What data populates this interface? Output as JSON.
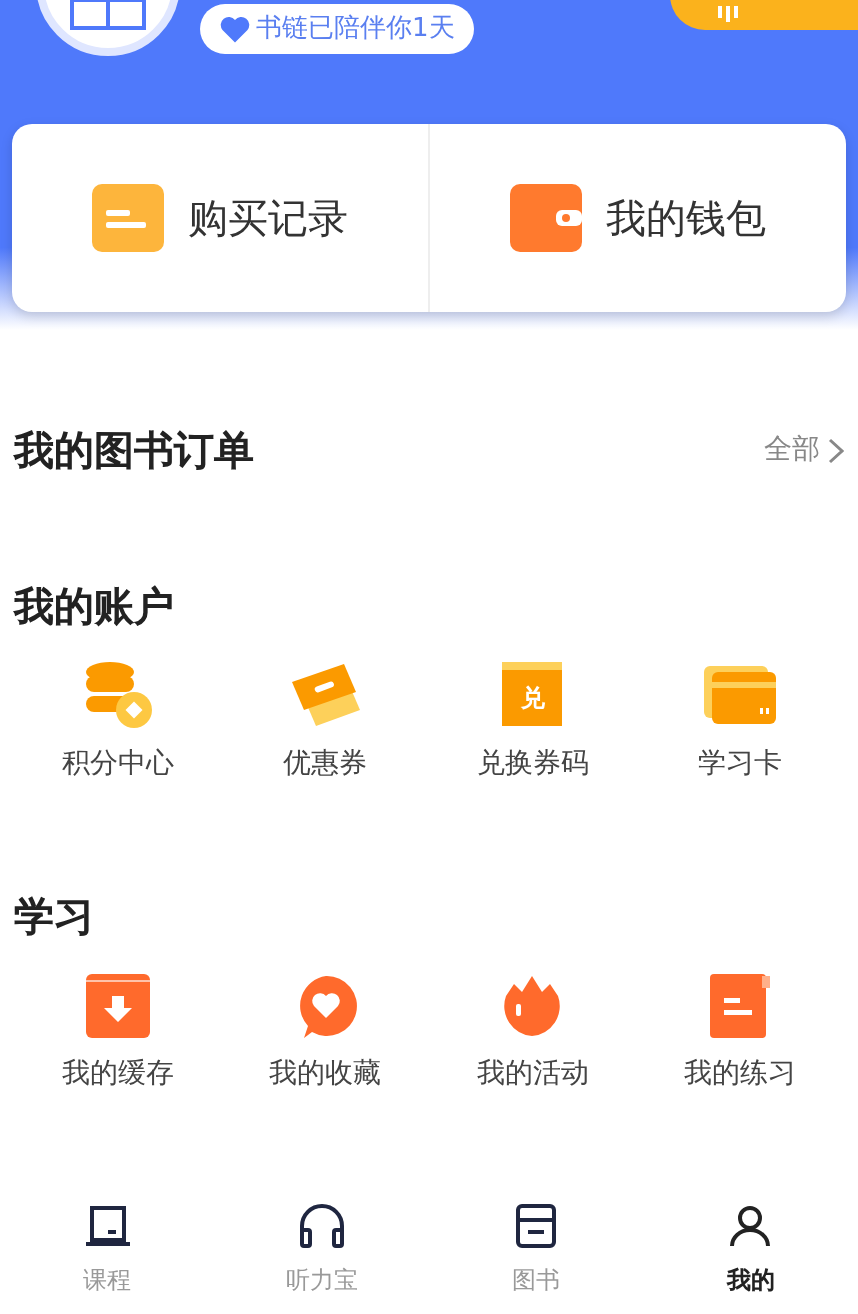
{
  "profile": {
    "badge": "书链已陪伴你1天"
  },
  "quick_links": [
    {
      "kind": "record",
      "label": "购买记录"
    },
    {
      "kind": "wallet",
      "label": "我的钱包"
    }
  ],
  "orders": {
    "title": "我的图书订单",
    "more": "全部"
  },
  "account": {
    "title": "我的账户",
    "items": [
      {
        "kind": "coins",
        "label": "积分中心"
      },
      {
        "kind": "coupon",
        "label": "优惠券"
      },
      {
        "kind": "redeem",
        "label": "兑换券码",
        "icon_text": "兑"
      },
      {
        "kind": "card",
        "label": "学习卡"
      }
    ]
  },
  "study": {
    "title": "学习",
    "items": [
      {
        "kind": "download",
        "label": "我的缓存"
      },
      {
        "kind": "heart",
        "label": "我的收藏"
      },
      {
        "kind": "flame",
        "label": "我的活动"
      },
      {
        "kind": "doc",
        "label": "我的练习"
      }
    ]
  },
  "tab_bar": [
    {
      "kind": "course",
      "label": "课程",
      "selected": false
    },
    {
      "kind": "audio",
      "label": "听力宝",
      "selected": false
    },
    {
      "kind": "book",
      "label": "图书",
      "selected": false
    },
    {
      "kind": "me",
      "label": "我的",
      "selected": true
    }
  ]
}
